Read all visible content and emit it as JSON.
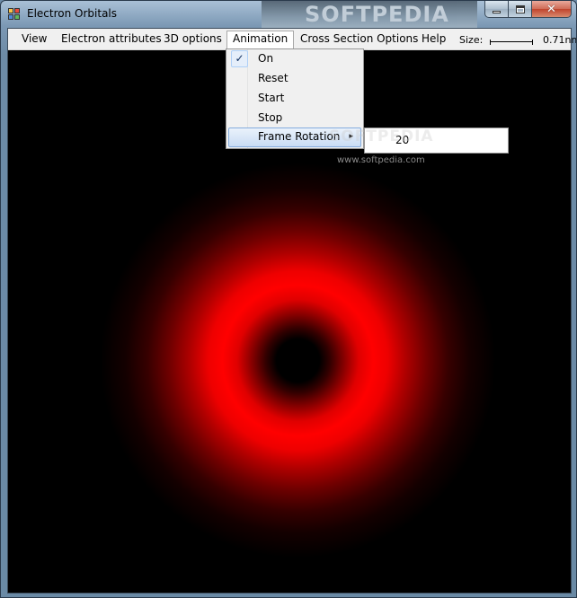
{
  "window": {
    "title": "Electron Orbitals",
    "banner_text": "SOFTPEDIA",
    "controls": {
      "minimize_icon": "minimize-icon",
      "maximize_icon": "maximize-icon",
      "close_icon": "close-icon",
      "close_glyph": "✕"
    }
  },
  "menubar": {
    "items": [
      {
        "label": "View"
      },
      {
        "label": "Electron attributes"
      },
      {
        "label": "3D options"
      },
      {
        "label": "Animation"
      },
      {
        "label": "Cross Section Options"
      },
      {
        "label": "Help"
      }
    ],
    "size_label": "Size:",
    "size_value": "0.71nm"
  },
  "animation_menu": {
    "items": [
      {
        "label": "On",
        "checked": true,
        "check_glyph": "✓"
      },
      {
        "label": "Reset"
      },
      {
        "label": "Start"
      },
      {
        "label": "Stop"
      },
      {
        "label": "Frame Rotation",
        "has_submenu": true,
        "arrow_glyph": "▸"
      }
    ]
  },
  "frame_rotation_submenu": {
    "items": [
      {
        "label": "20"
      }
    ]
  },
  "canvas": {
    "watermark_small": "www.softpedia.com",
    "watermark_big": "SOFTPEDIA",
    "orbital_color": "#ff0000",
    "background_color": "#000000"
  }
}
